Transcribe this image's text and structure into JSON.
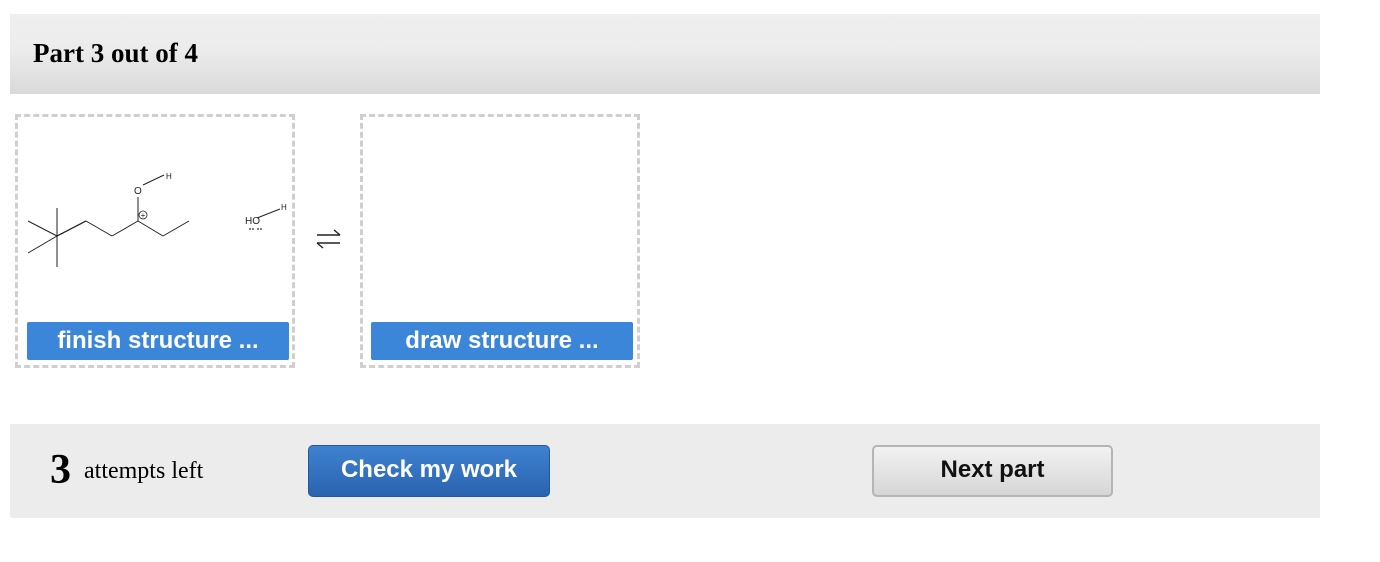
{
  "header": {
    "title": "Part 3 out of 4"
  },
  "reactant": {
    "button_label": "finish structure ...",
    "atoms": {
      "oxygen": "O",
      "hydrogen": "H",
      "charge": "+",
      "hydroxide": "HO"
    }
  },
  "product": {
    "button_label": "draw structure ..."
  },
  "equilibrium_icon": "equilibrium-arrows-icon",
  "footer": {
    "attempts_count": "3",
    "attempts_label": "attempts left",
    "check_label": "Check my work",
    "next_label": "Next part"
  },
  "colors": {
    "structure_button": "#3b86d8",
    "check_button": "#2f6fc0",
    "header_bg": "#e6e6e6",
    "footer_bg": "#ececec"
  }
}
